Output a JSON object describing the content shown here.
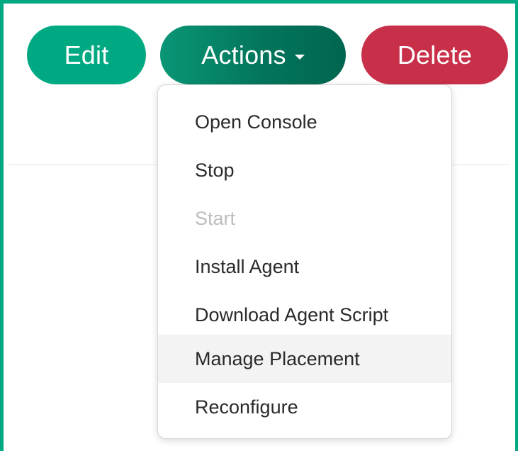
{
  "toolbar": {
    "edit_label": "Edit",
    "actions_label": "Actions",
    "delete_label": "Delete"
  },
  "actions_menu": {
    "expanded": true,
    "items": [
      {
        "label": "Open Console",
        "enabled": true
      },
      {
        "label": "Stop",
        "enabled": true
      },
      {
        "label": "Start",
        "enabled": false
      },
      {
        "label": "Install Agent",
        "enabled": true
      },
      {
        "label": "Download Agent Script",
        "enabled": true
      },
      {
        "label": "Manage Placement",
        "enabled": true,
        "hovered": true
      },
      {
        "label": "Reconfigure",
        "enabled": true
      }
    ]
  },
  "colors": {
    "frame_border": "#01a982",
    "edit_button": "#01a982",
    "actions_button": "#03755c",
    "delete_button": "#c8304a",
    "disabled_text": "#bdbdbd",
    "hover_background": "#f3f3f3"
  },
  "icons": {
    "actions_caret": "chevron-down-icon"
  }
}
